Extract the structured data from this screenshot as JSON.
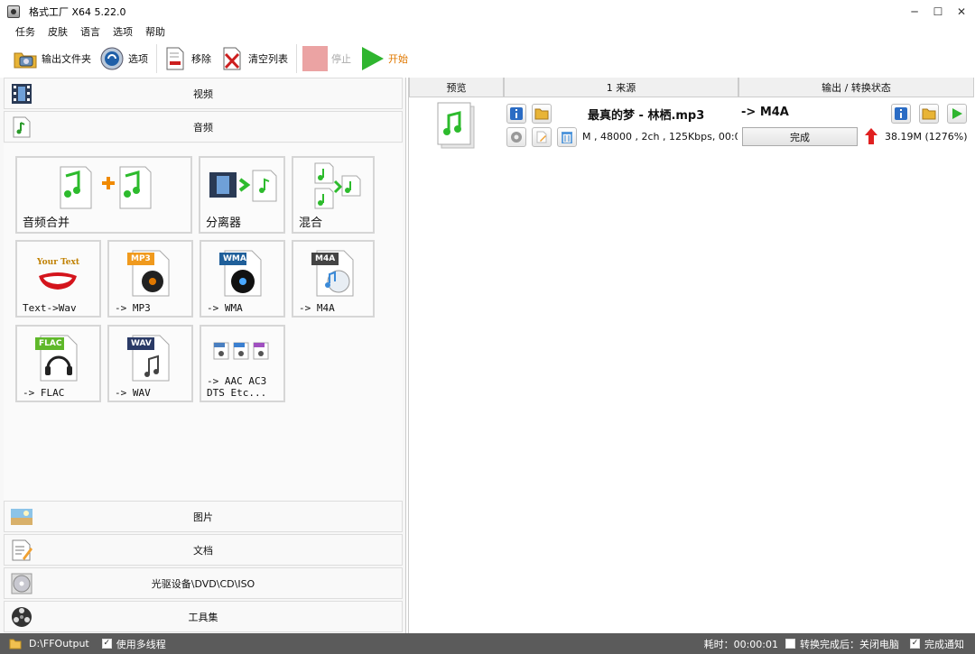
{
  "window": {
    "title": "格式工厂 X64 5.22.0",
    "minimize": "─",
    "maximize": "☐",
    "close": "✕"
  },
  "menu": [
    "任务",
    "皮肤",
    "语言",
    "选项",
    "帮助"
  ],
  "toolbar": {
    "output_folder": "输出文件夹",
    "options": "选项",
    "remove": "移除",
    "clear_list": "清空列表",
    "stop": "停止",
    "start": "开始"
  },
  "categories": {
    "video": "视频",
    "audio": "音频",
    "picture": "图片",
    "document": "文档",
    "disc": "光驱设备\\DVD\\CD\\ISO",
    "tools": "工具集"
  },
  "audio_tiles": {
    "merge": "音频合并",
    "splitter": "分离器",
    "mix": "混合",
    "text_to_wav": "Text->Wav",
    "to_mp3": "-> MP3",
    "to_wma": "-> WMA",
    "to_m4a": "-> M4A",
    "to_flac": "-> FLAC",
    "to_wav": "-> WAV",
    "to_others_line1": "-> AAC AC3",
    "to_others_line2": "DTS Etc..."
  },
  "tile_badges": {
    "mp3": "MP3",
    "wma": "WMA",
    "m4a": "M4A",
    "flac": "FLAC",
    "wav": "WAV",
    "your_text": "Your Text"
  },
  "task_list": {
    "headers": {
      "preview": "预览",
      "source": "1 来源",
      "output": "输出 / 转换状态"
    },
    "task": {
      "filename": "最真的梦 - 林栖.mp3",
      "target": "-> M4A",
      "details": "M , 48000 , 2ch , 125Kbps, 00:0",
      "status": "完成",
      "size_info": "38.19M (1276%)"
    }
  },
  "status": {
    "output_path": "D:\\FFOutput",
    "multithread": "使用多线程",
    "elapsed": "耗时：00:00:01",
    "after_convert": "转换完成后：关闭电脑",
    "notify": "完成通知"
  },
  "colors": {
    "accent_orange": "#e07800",
    "status_bar": "#5b5b5b",
    "start_green": "#2fb52f",
    "up_arrow": "#e02020"
  }
}
